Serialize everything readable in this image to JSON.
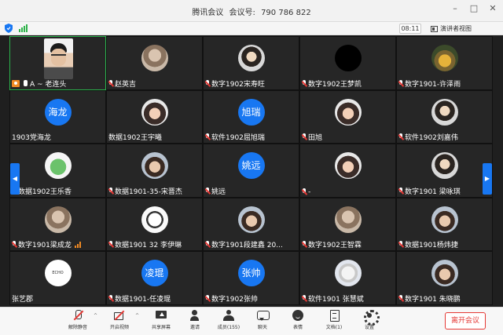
{
  "window": {
    "app_title": "腾讯会议",
    "meeting_id_label": "会议号:",
    "meeting_id": "790 786 822"
  },
  "subbar": {
    "timer": "08:11",
    "view_label": "演讲者视图"
  },
  "participants": [
    {
      "name": "A ~ 老连头",
      "avatar": "camera",
      "host": true
    },
    {
      "name": "赵英吉",
      "avatar": "photo"
    },
    {
      "name": "数字1902宋寿旺",
      "avatar": "photo2"
    },
    {
      "name": "数字1902王梦凯",
      "avatar": "black"
    },
    {
      "name": "数字1901-许泽雨",
      "avatar": "sunflower"
    },
    {
      "name": "1903党海龙",
      "avatar": "text",
      "avatar_text": "海龙",
      "muted": false
    },
    {
      "name": "数据1902王宇曦",
      "avatar": "anime",
      "muted": false
    },
    {
      "name": "软件1902屈旭瑞",
      "avatar": "text",
      "avatar_text": "旭瑞"
    },
    {
      "name": "田旭",
      "avatar": "anime"
    },
    {
      "name": "软件1902刘嘉伟",
      "avatar": "photo2"
    },
    {
      "name": "数据1902王乐香",
      "avatar": "frog"
    },
    {
      "name": "数据1901-35-宋晋杰",
      "avatar": "boy"
    },
    {
      "name": "姚远",
      "avatar": "text",
      "avatar_text": "姚远"
    },
    {
      "name": "-",
      "avatar": "anime"
    },
    {
      "name": "数字1901  梁咏琪",
      "avatar": "photo2"
    },
    {
      "name": "数字1901梁成龙",
      "avatar": "photo",
      "speaking": true
    },
    {
      "name": "数据1901 32 李伊琳",
      "avatar": "panda"
    },
    {
      "name": "数字1901段建鑫 20...",
      "avatar": "boy"
    },
    {
      "name": "数字1902王智霖",
      "avatar": "photo"
    },
    {
      "name": "数据1901杨炜捷",
      "avatar": "boy"
    },
    {
      "name": "张艺郡",
      "avatar": "white",
      "avatar_text": "ECHO",
      "muted": false
    },
    {
      "name": "数据1901-任凌琨",
      "avatar": "text",
      "avatar_text": "凌琨"
    },
    {
      "name": "数字1902张帅",
      "avatar": "text",
      "avatar_text": "张帅"
    },
    {
      "name": "软件1901 张慧斌",
      "avatar": "cat"
    },
    {
      "name": "数字1901 朱晓鹏",
      "avatar": "boy"
    }
  ],
  "toolbar": {
    "unmute": "解除静音",
    "start_video": "开启视频",
    "share_screen": "共享屏幕",
    "invite": "邀请",
    "members": "成员(155)",
    "chat": "聊天",
    "reactions": "表情",
    "documents": "文档(1)",
    "settings": "设置",
    "leave": "离开会议"
  },
  "colors": {
    "accent": "#1877f2",
    "leave": "#e53935",
    "active_speaker": "#2bb24c",
    "host": "#f08a24"
  }
}
